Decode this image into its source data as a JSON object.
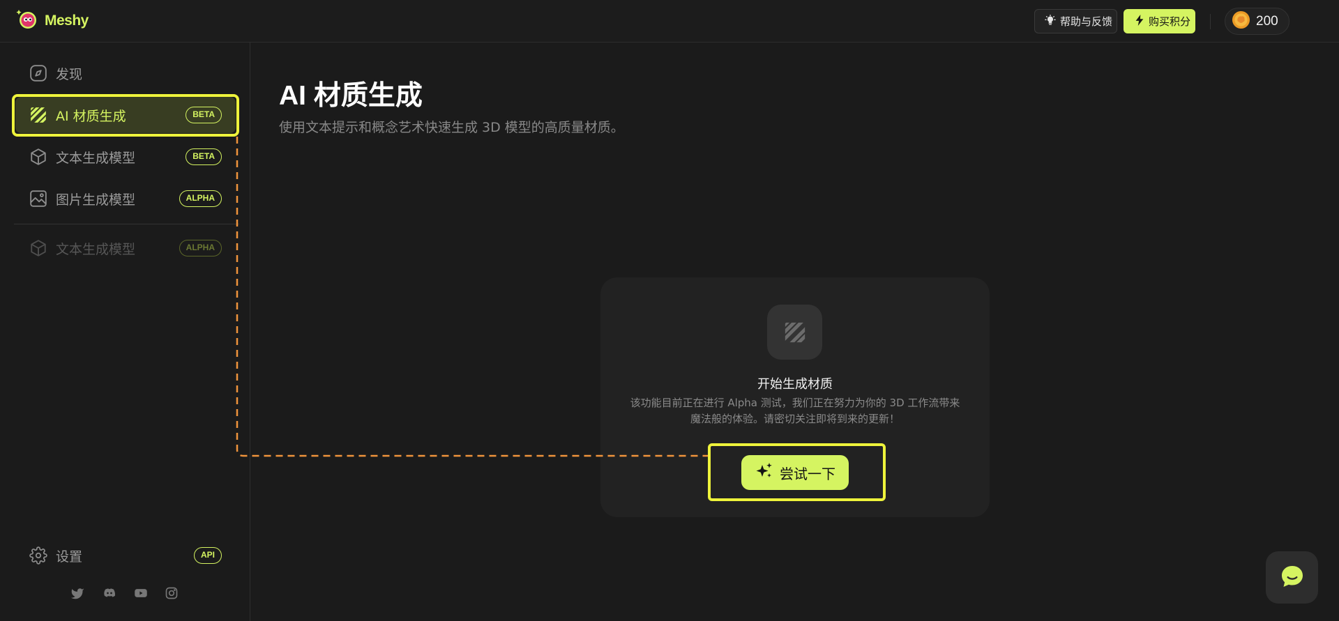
{
  "app": {
    "name": "Meshy"
  },
  "header": {
    "help_label": "帮助与反馈",
    "help_icon": "lightbulb-icon",
    "buy_label": "购买积分",
    "buy_icon": "lightning-icon",
    "credits": "200",
    "credits_icon": "coin-icon"
  },
  "sidebar": {
    "items": [
      {
        "label": "发现",
        "icon": "compass-icon",
        "badge": ""
      },
      {
        "label": "AI 材质生成",
        "icon": "texture-stripes-icon",
        "badge": "BETA",
        "active": true
      },
      {
        "label": "文本生成模型",
        "icon": "cube-icon",
        "badge": "BETA"
      },
      {
        "label": "图片生成模型",
        "icon": "image-icon",
        "badge": "ALPHA"
      },
      {
        "label": "文本生成模型",
        "icon": "cube-icon",
        "badge": "ALPHA",
        "disabled": true
      }
    ],
    "settings": {
      "label": "设置",
      "icon": "gear-icon",
      "badge": "API"
    },
    "social": [
      "twitter-icon",
      "discord-icon",
      "youtube-icon",
      "instagram-icon"
    ]
  },
  "main": {
    "title": "AI 材质生成",
    "subtitle": "使用文本提示和概念艺术快速生成 3D 模型的高质量材质。",
    "card": {
      "icon": "texture-stripes-icon",
      "heading": "开始生成材质",
      "description_line1": "该功能目前正在进行 Alpha 测试，我们正在努力为你的 3D 工作流带来",
      "description_line2": "魔法般的体验。请密切关注即将到来的更新！",
      "cta_label": "尝试一下",
      "cta_icon": "sparkles-icon"
    }
  },
  "chat_widget": {
    "icon": "chat-bubble-icon"
  },
  "colors": {
    "background": "#1b1b1b",
    "accent": "#d5f461",
    "active_item_bg": "#383d22",
    "card_bg": "#222222",
    "annotation_outline": "#eef33b",
    "annotation_connector": "#f0943c"
  }
}
